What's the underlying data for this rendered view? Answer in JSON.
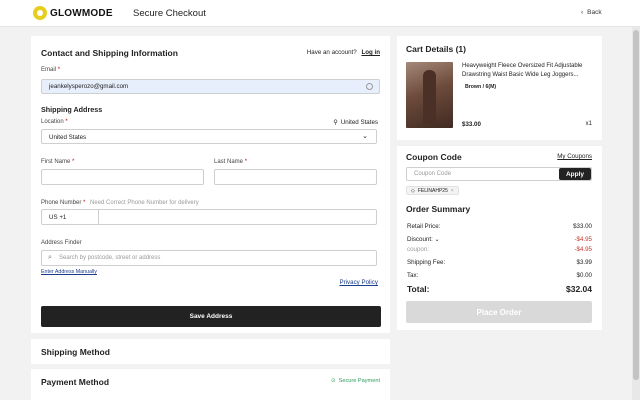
{
  "brand": {
    "name": "GLOWMODE"
  },
  "header": {
    "title": "Secure Checkout",
    "back_label": "Back"
  },
  "contact": {
    "title": "Contact and Shipping Information",
    "have_account": "Have an account?",
    "login": "Log in",
    "email_label": "Email",
    "email_value": "jeankelysperozo@gmail.com"
  },
  "shipping_address": {
    "title": "Shipping Address",
    "location_label": "Location",
    "location_badge": "United States",
    "country_value": "United States",
    "first_name_label": "First Name",
    "last_name_label": "Last Name",
    "phone_label": "Phone Number",
    "phone_hint": "Need Correct Phone Number for delivery",
    "phone_prefix": "US +1",
    "address_finder_label": "Address Finder",
    "address_placeholder": "Search by postcode, street or address",
    "enter_manually": "Enter Address Manually",
    "privacy_policy": "Privacy Policy",
    "save_button": "Save Address"
  },
  "shipping_method": {
    "title": "Shipping Method"
  },
  "payment_method": {
    "title": "Payment Method",
    "secure_label": "Secure Payment"
  },
  "cart": {
    "title": "Cart Details (1)",
    "item": {
      "name": "Heavyweight Fleece Oversized Fit Adjustable Drawstring Waist Basic Wide Leg Joggers...",
      "variant": "Brown / 6(M)",
      "price": "$33.00",
      "qty": "x1"
    }
  },
  "coupon": {
    "title": "Coupon Code",
    "my_coupons": "My Coupons",
    "placeholder": "Coupon Code",
    "apply": "Apply",
    "applied_tag": "FELINAHP25"
  },
  "summary": {
    "title": "Order Summary",
    "rows": [
      {
        "label": "Retail Price:",
        "value": "$33.00"
      },
      {
        "label": "Discount:",
        "value": "-$4.95"
      },
      {
        "label": "coupon:",
        "value": "-$4.95"
      },
      {
        "label": "Shipping Fee:",
        "value": "$3.99"
      },
      {
        "label": "Tax:",
        "value": "$0.00"
      }
    ],
    "total_label": "Total:",
    "total_value": "$32.04",
    "place_order": "Place Order"
  },
  "colors": {
    "accent_yellow": "#e6ce1e",
    "dark_button": "#222222",
    "discount_red": "#c9372c",
    "secure_green": "#2e9b5a",
    "disabled_button": "#d9d9d9"
  }
}
